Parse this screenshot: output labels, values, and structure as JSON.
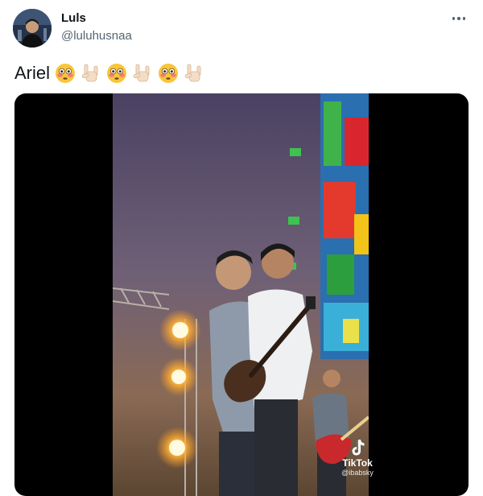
{
  "author": {
    "display_name": "Luls",
    "handle": "@luluhusnaa"
  },
  "tweet": {
    "text": "Ariel",
    "emojis": [
      "flushed-face",
      "sign-of-horns",
      "flushed-face",
      "sign-of-horns",
      "flushed-face",
      "sign-of-horns"
    ]
  },
  "media": {
    "watermark_brand": "TikTok",
    "watermark_user": "@ibabsky"
  },
  "colors": {
    "name": "#0f1419",
    "secondary": "#536471",
    "media_bg": "#000000"
  }
}
